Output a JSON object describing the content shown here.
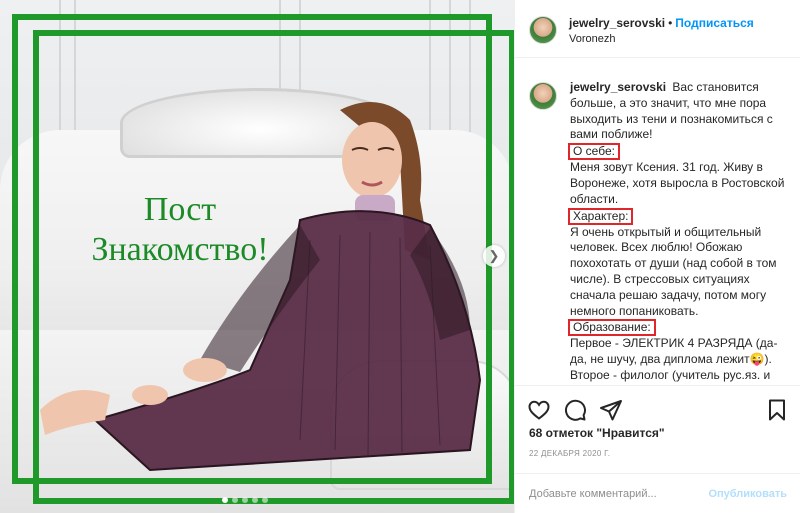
{
  "post_image": {
    "overlay_title_line1": "Пост",
    "overlay_title_line2": "Знакомство!",
    "frame_color": "#1f9a2a",
    "slide_count": 5,
    "active_slide": 1,
    "next_icon": "chevron-right-icon"
  },
  "header": {
    "username": "jewelry_serovski",
    "separator": "•",
    "follow_label": "Подписаться",
    "location": "Voronezh"
  },
  "caption": {
    "username": "jewelry_serovski",
    "intro": "Вас становится больше, а это значит, что мне пора выходить из тени и познакомиться с вами поближе!",
    "about_heading": "О себе:",
    "about_text": "Меня зовут Ксения. 31 год. Живу в Воронеже, хотя выросла в Ростовской области.",
    "character_heading": "Характер:",
    "character_text": "Я очень открытый и общительный человек. Всех люблю! Обожаю похохотать от души (над собой в том числе). В стрессовых ситуациях сначала решаю задачу, потом могу немного попаниковать.",
    "education_heading": "Образование:",
    "education_text1": "Первое - ЭЛЕКТРИК 4 РАЗРЯДА (да-да, не шучу, два диплома лежит😜).",
    "education_text2": "Второе - филолог (учитель рус.яз. и литературы)",
    "highlight_color": "#e0262b"
  },
  "actions": {
    "icons": [
      "heart-icon",
      "comment-icon",
      "share-icon",
      "bookmark-icon"
    ]
  },
  "likes": "68 отметок \"Нравится\"",
  "date": "22 ДЕКАБРЯ 2020 Г.",
  "add_comment": {
    "placeholder": "Добавьте комментарий...",
    "publish_label": "Опубликовать"
  }
}
